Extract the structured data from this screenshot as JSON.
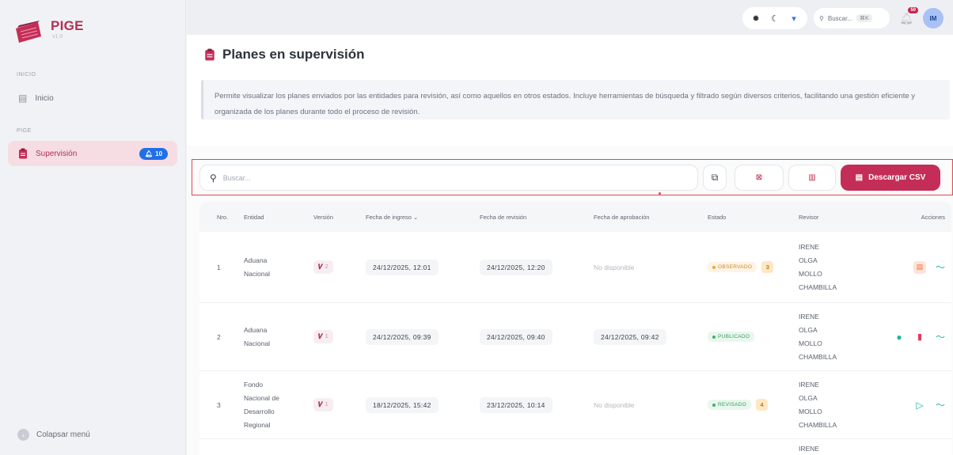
{
  "app": {
    "title": "PIGE",
    "version": "v1.0"
  },
  "sidebar": {
    "sections": [
      {
        "label": "INICIO"
      },
      {
        "label": "PIGE"
      }
    ],
    "items": [
      {
        "label": "Inicio",
        "icon": "home-icon"
      },
      {
        "label": "Supervisión",
        "icon": "clipboard-icon",
        "badge": "10"
      }
    ],
    "collapse_label": "Colapsar menú"
  },
  "topbar": {
    "search_placeholder": "Buscar...",
    "search_shortcut": "⌘K",
    "notification_count": "50",
    "avatar_initials": "IM"
  },
  "page": {
    "title": "Planes en supervisión",
    "description": "Permite visualizar los planes enviados por las entidades para revisión, así como aquellos en otros estados. Incluye herramientas de búsqueda y filtrado según diversos criterios, facilitando una gestión eficiente y organizada de los planes durante todo el proceso de revisión."
  },
  "toolbar": {
    "search_placeholder": "Buscar...",
    "csv_label": "Descargar CSV"
  },
  "table": {
    "headers": {
      "no": "Nro.",
      "entity": "Entidad",
      "version": "Versión",
      "entry_date": "Fecha de ingreso",
      "review_date": "Fecha de revisión",
      "approval_date": "Fecha de aprobación",
      "status": "Estado",
      "reviewer": "Revisor",
      "actions": "Acciones"
    },
    "rows": [
      {
        "no": "1",
        "entity_lines": [
          "Aduana",
          "Nacional"
        ],
        "version": "2",
        "entry_date": "24/12/2025, 12:01",
        "review_date": "24/12/2025, 12:20",
        "approval_date": "No disponible",
        "status": "OBSERVADO",
        "count": "3",
        "reviewer_lines": [
          "IRENE",
          "OLGA",
          "MOLLO",
          "CHAMBILLA"
        ]
      },
      {
        "no": "2",
        "entity_lines": [
          "Aduana",
          "Nacional"
        ],
        "version": "1",
        "entry_date": "24/12/2025, 09:39",
        "review_date": "24/12/2025, 09:40",
        "approval_date": "24/12/2025, 09:42",
        "status": "PUBLICADO",
        "count": "",
        "reviewer_lines": [
          "IRENE",
          "OLGA",
          "MOLLO",
          "CHAMBILLA"
        ]
      },
      {
        "no": "3",
        "entity_lines": [
          "Fondo",
          "Nacional de",
          "Desarrollo",
          "Regional"
        ],
        "version": "1",
        "entry_date": "18/12/2025, 15:42",
        "review_date": "23/12/2025, 10:14",
        "approval_date": "No disponible",
        "status": "REVISADO",
        "count": "4",
        "reviewer_lines": [
          "IRENE",
          "OLGA",
          "MOLLO",
          "CHAMBILLA"
        ]
      },
      {
        "no": "",
        "entity_lines": [
          ""
        ],
        "version": "",
        "entry_date": "",
        "review_date": "",
        "approval_date": "",
        "status": "",
        "count": "",
        "reviewer_lines": [
          "IRENE"
        ]
      }
    ]
  },
  "colors": {
    "brand": "#c42d57",
    "badge": "#1f6fe8",
    "accent_teal": "#1bb3a6"
  }
}
